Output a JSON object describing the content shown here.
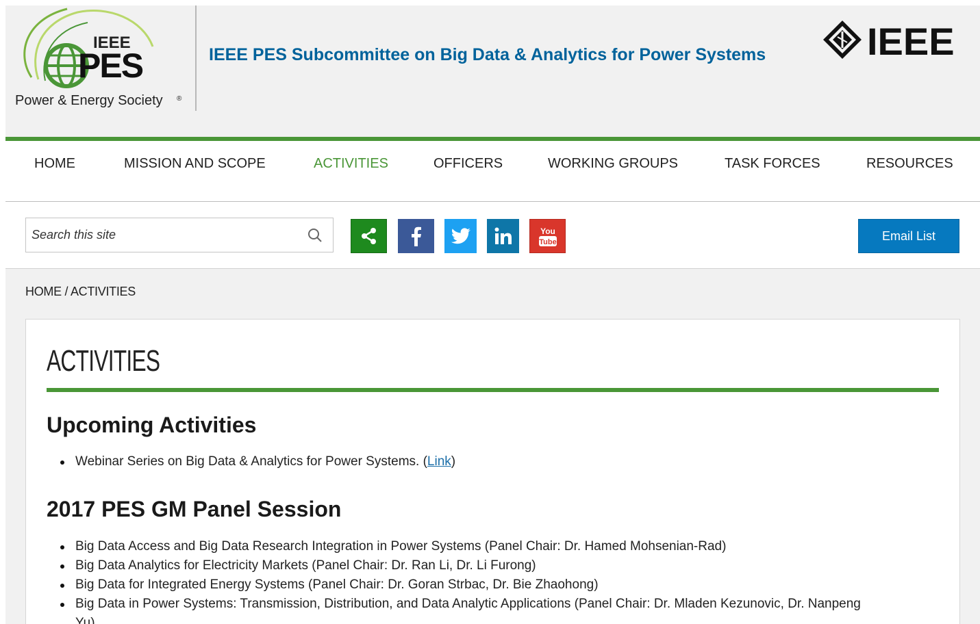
{
  "header": {
    "logo_ieee": "IEEE",
    "logo_pes": "PES",
    "logo_tagline": "Power & Energy Society",
    "site_title": "IEEE PES Subcommittee on Big Data & Analytics for Power Systems",
    "ieee_logo": "IEEE"
  },
  "nav": {
    "items": [
      {
        "label": "HOME"
      },
      {
        "label": "MISSION AND SCOPE"
      },
      {
        "label": "ACTIVITIES",
        "active": true
      },
      {
        "label": "OFFICERS"
      },
      {
        "label": "WORKING GROUPS"
      },
      {
        "label": "TASK FORCES"
      },
      {
        "label": "RESOURCES"
      }
    ]
  },
  "toolbar": {
    "search_placeholder": "Search this site",
    "social": [
      {
        "icon": "share-icon",
        "color": "#1e8a1e"
      },
      {
        "icon": "facebook-icon",
        "color": "#3b5998"
      },
      {
        "icon": "twitter-icon",
        "color": "#1da1f2"
      },
      {
        "icon": "linkedin-icon",
        "color": "#0e76a8"
      },
      {
        "icon": "youtube-icon",
        "color": "#d9362b"
      }
    ],
    "email_label": "Email List"
  },
  "breadcrumb": {
    "home": "HOME",
    "separator": "/",
    "current": "ACTIVITIES"
  },
  "main": {
    "title": "ACTIVITIES",
    "sections": [
      {
        "heading": "Upcoming Activities",
        "items": [
          {
            "text": "Webinar Series on Big Data & Analytics for Power Systems. (",
            "link": "Link",
            "after": ")"
          }
        ]
      },
      {
        "heading": "2017 PES GM Panel Session",
        "items": [
          {
            "text": "Big Data Access and Big Data Research Integration in Power Systems (Panel Chair: Dr. Hamed Mohsenian-Rad)"
          },
          {
            "text": "Big Data Analytics for Electricity Markets (Panel Chair:  Dr. Ran Li, Dr. Li Furong)"
          },
          {
            "text": "Big Data for Integrated Energy Systems (Panel Chair: Dr. Goran Strbac, Dr. Bie Zhaohong)"
          },
          {
            "text": "Big Data in Power Systems: Transmission, Distribution, and Data Analytic Applications (Panel Chair: Dr. Mladen Kezunovic, Dr. Nanpeng",
            "continuation": "Yu)"
          }
        ]
      }
    ]
  },
  "colors": {
    "accent_green": "#4a9637",
    "title_blue": "#00629b",
    "email_button": "#0679bf"
  }
}
